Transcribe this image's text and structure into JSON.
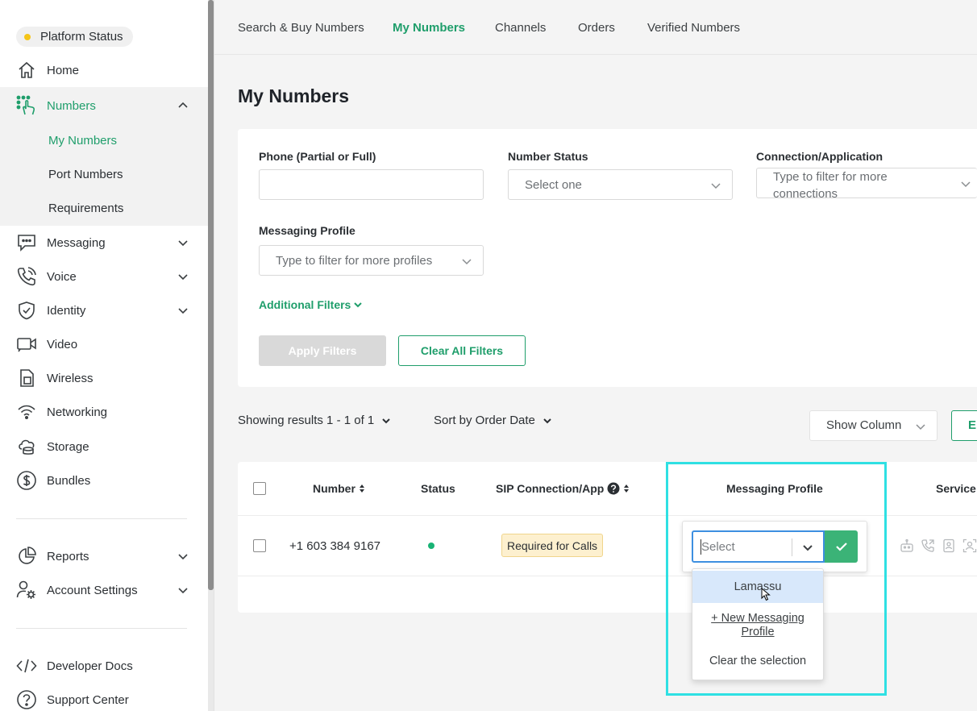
{
  "platform_status": "Platform Status",
  "sidebar": {
    "items": [
      {
        "label": "Home"
      },
      {
        "label": "Numbers"
      },
      {
        "label": "Messaging"
      },
      {
        "label": "Voice"
      },
      {
        "label": "Identity"
      },
      {
        "label": "Video"
      },
      {
        "label": "Wireless"
      },
      {
        "label": "Networking"
      },
      {
        "label": "Storage"
      },
      {
        "label": "Bundles"
      },
      {
        "label": "Reports"
      },
      {
        "label": "Account Settings"
      },
      {
        "label": "Developer Docs"
      },
      {
        "label": "Support Center"
      }
    ],
    "numbers_sub": [
      "My Numbers",
      "Port Numbers",
      "Requirements"
    ]
  },
  "tabs": [
    "Search & Buy Numbers",
    "My Numbers",
    "Channels",
    "Orders",
    "Verified Numbers"
  ],
  "page_title": "My Numbers",
  "filters": {
    "phone_label": "Phone (Partial or Full)",
    "phone_value": "",
    "status_label": "Number Status",
    "status_placeholder": "Select one",
    "connection_label": "Connection/Application",
    "connection_placeholder_line1": "Type to filter for more",
    "connection_placeholder_line2": "connections",
    "messaging_label": "Messaging Profile",
    "messaging_placeholder": "Type to filter for more profiles",
    "additional": "Additional Filters",
    "apply": "Apply Filters",
    "clear": "Clear All Filters"
  },
  "results": {
    "showing": "Showing results 1 - 1 of 1",
    "sort": "Sort by Order Date",
    "show_column": "Show Column",
    "export_partial": "E"
  },
  "table": {
    "headers": {
      "number": "Number",
      "status": "Status",
      "sip": "SIP Connection/App",
      "messaging": "Messaging Profile",
      "services": "Service"
    },
    "rows": [
      {
        "number": "+1 603 384 9167",
        "status": "active",
        "sip_badge": "Required for Calls"
      }
    ]
  },
  "editor": {
    "placeholder": "Select",
    "options": [
      "Lamassu",
      "+ New Messaging Profile",
      "Clear the selection"
    ],
    "new_line1": "+ New Messaging",
    "new_line2": "Profile"
  },
  "colors": {
    "accent": "#1f9e6b",
    "highlight": "#2fe0e3",
    "status_dot": "#19b375",
    "badge_bg": "#fdf0cf"
  }
}
